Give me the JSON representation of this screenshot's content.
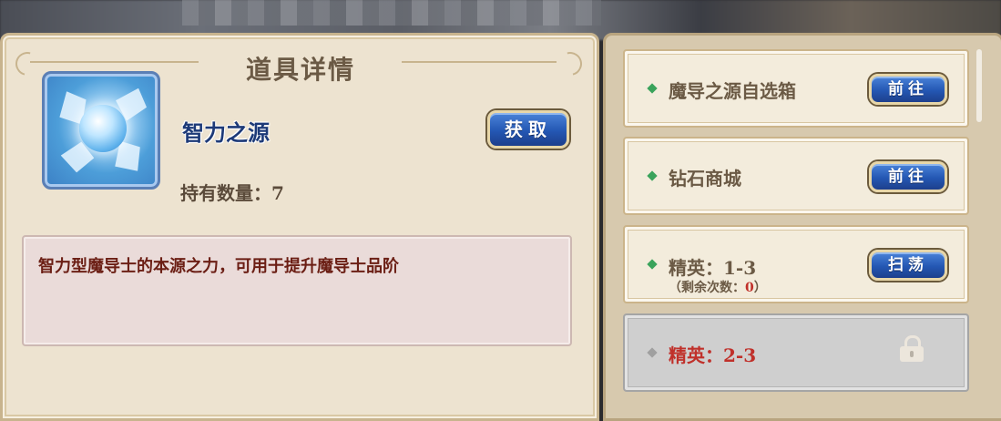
{
  "detail_panel": {
    "title": "道具详情",
    "item": {
      "icon": "intelligence-source-orb-icon",
      "name": "智力之源",
      "quantity_label": "持有数量：",
      "quantity_value": "7"
    },
    "obtain_button_label": "获取",
    "description": "智力型魔导士的本源之力，可用于提升魔导士品阶"
  },
  "sources_panel": {
    "entries": [
      {
        "label": "魔导之源自选箱",
        "button_label": "前往",
        "locked": false
      },
      {
        "label": "钻石商城",
        "button_label": "前往",
        "locked": false
      },
      {
        "label": "精英：1-3",
        "sub_prefix": "（剩余次数：",
        "sub_value": "0",
        "sub_suffix": "）",
        "button_label": "扫荡",
        "locked": false
      },
      {
        "label": "精英：2-3",
        "locked": true,
        "icon": "lock-icon"
      }
    ]
  },
  "colors": {
    "panel_bg": "#ede3d0",
    "button_blue": "#2457b3",
    "description_text": "#6b1e14",
    "locked_label": "#c0302a"
  }
}
